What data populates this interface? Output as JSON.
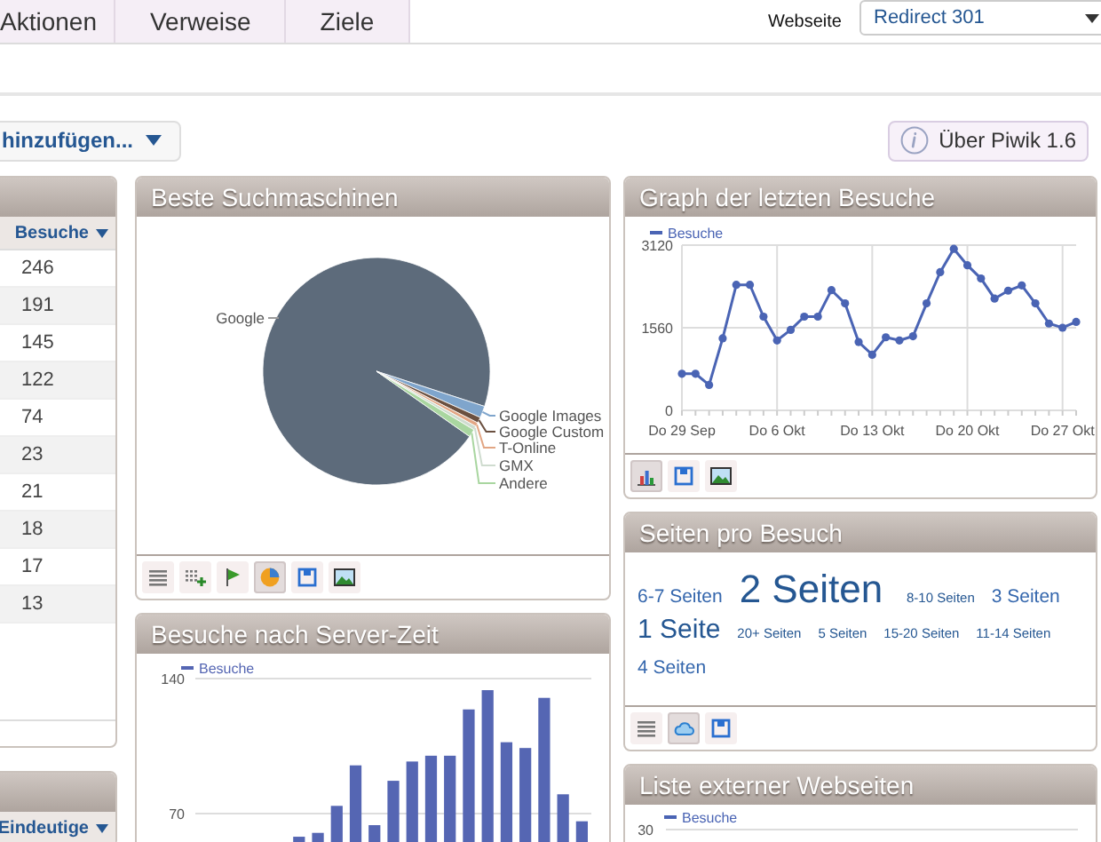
{
  "nav": {
    "tabs": [
      {
        "label": "Aktionen",
        "selected": false
      },
      {
        "label": "Verweise",
        "selected": false
      },
      {
        "label": "Ziele",
        "selected": false
      }
    ],
    "site_label": "Webseite",
    "site_select": {
      "value": "Redirect 301"
    }
  },
  "actions": {
    "add_widget": "hinzufügen...",
    "about": "Über Piwik 1.6"
  },
  "left": [
    {
      "kind": "table",
      "column": "Besuche",
      "rows": [
        "246",
        "191",
        "145",
        "122",
        "74",
        "23",
        "21",
        "18",
        "17",
        "13"
      ]
    },
    {
      "kind": "table",
      "column": "Eindeutige"
    }
  ],
  "middle": [
    {
      "kind": "pie",
      "title": "Beste Suchmaschinen",
      "slices": [
        {
          "label": "Google",
          "color": "#5d6b7b"
        },
        {
          "label": "Google Images",
          "color": "#7fa5cc"
        },
        {
          "label": "Google Custom",
          "color": "#6b5040"
        },
        {
          "label": "T-Online",
          "color": "#e2a684"
        },
        {
          "label": "GMX",
          "color": "#cfdccf"
        },
        {
          "label": "Andere",
          "color": "#a9d6a0"
        }
      ],
      "tools": [
        {
          "kind": "table",
          "selected": false
        },
        {
          "kind": "table_more",
          "selected": false
        },
        {
          "kind": "goals",
          "selected": false
        },
        {
          "kind": "pie",
          "selected": true
        },
        {
          "kind": "save",
          "selected": false
        },
        {
          "kind": "image",
          "selected": false
        }
      ]
    },
    {
      "kind": "chart",
      "title": "Besuche nach Server-Zeit",
      "chart_data": {
        "type": "bar",
        "ylim": [
          0,
          140
        ],
        "yticks": [
          70,
          140
        ],
        "series": [
          {
            "name": "Besuche",
            "color": "#5566b3",
            "values": [
              null,
              null,
              null,
              null,
              null,
              58,
              60,
              74,
              95,
              64,
              87,
              97,
              100,
              100,
              124,
              134,
              107,
              104,
              130,
              80,
              66
            ]
          }
        ]
      }
    }
  ],
  "right": [
    {
      "kind": "chart",
      "title": "Graph der letzten Besuche",
      "chart_data": {
        "type": "line",
        "categories": [
          "Do 29 Sep",
          null,
          null,
          null,
          null,
          null,
          null,
          "Do 6 Okt",
          null,
          null,
          null,
          null,
          null,
          null,
          "Do 13 Okt",
          null,
          null,
          null,
          null,
          null,
          null,
          "Do 20 Okt",
          null,
          null,
          null,
          null,
          null,
          null,
          "Do 27 Okt",
          null
        ],
        "ylim": [
          0,
          3120
        ],
        "yticks": [
          0,
          1560,
          3120
        ],
        "grid": true,
        "series": [
          {
            "name": "Besuche",
            "color": "#4a64b4",
            "marker": "circle",
            "values": [
              690,
              690,
              480,
              1360,
              2370,
              2370,
              1770,
              1320,
              1520,
              1770,
              1770,
              2270,
              2020,
              1290,
              1050,
              1380,
              1320,
              1400,
              2020,
              2610,
              3050,
              2740,
              2490,
              2110,
              2260,
              2360,
              2020,
              1640,
              1560,
              1670
            ]
          }
        ]
      },
      "tools": [
        {
          "kind": "bar",
          "selected": true
        },
        {
          "kind": "save",
          "selected": false
        },
        {
          "kind": "image",
          "selected": false
        }
      ]
    },
    {
      "kind": "cloud",
      "title": "Seiten pro Besuch",
      "tags": [
        {
          "label": "6-7 Seiten",
          "kind": "m"
        },
        {
          "label": "2 Seiten",
          "kind": "xl"
        },
        {
          "label": "8-10 Seiten",
          "kind": "s"
        },
        {
          "label": "3 Seiten",
          "kind": "m"
        },
        {
          "label": "1 Seite",
          "kind": "l"
        },
        {
          "label": "20+ Seiten",
          "kind": "s"
        },
        {
          "label": "5 Seiten",
          "kind": "s"
        },
        {
          "label": "15-20 Seiten",
          "kind": "s"
        },
        {
          "label": "11-14 Seiten",
          "kind": "s"
        },
        {
          "label": "4 Seiten",
          "kind": "m"
        }
      ],
      "tools": [
        {
          "kind": "table",
          "selected": false
        },
        {
          "kind": "cloud",
          "selected": true
        },
        {
          "kind": "save",
          "selected": false
        }
      ]
    },
    {
      "kind": "stub",
      "title": "Liste externer Webseiten",
      "legend": "Besuche",
      "tick": "30"
    }
  ]
}
